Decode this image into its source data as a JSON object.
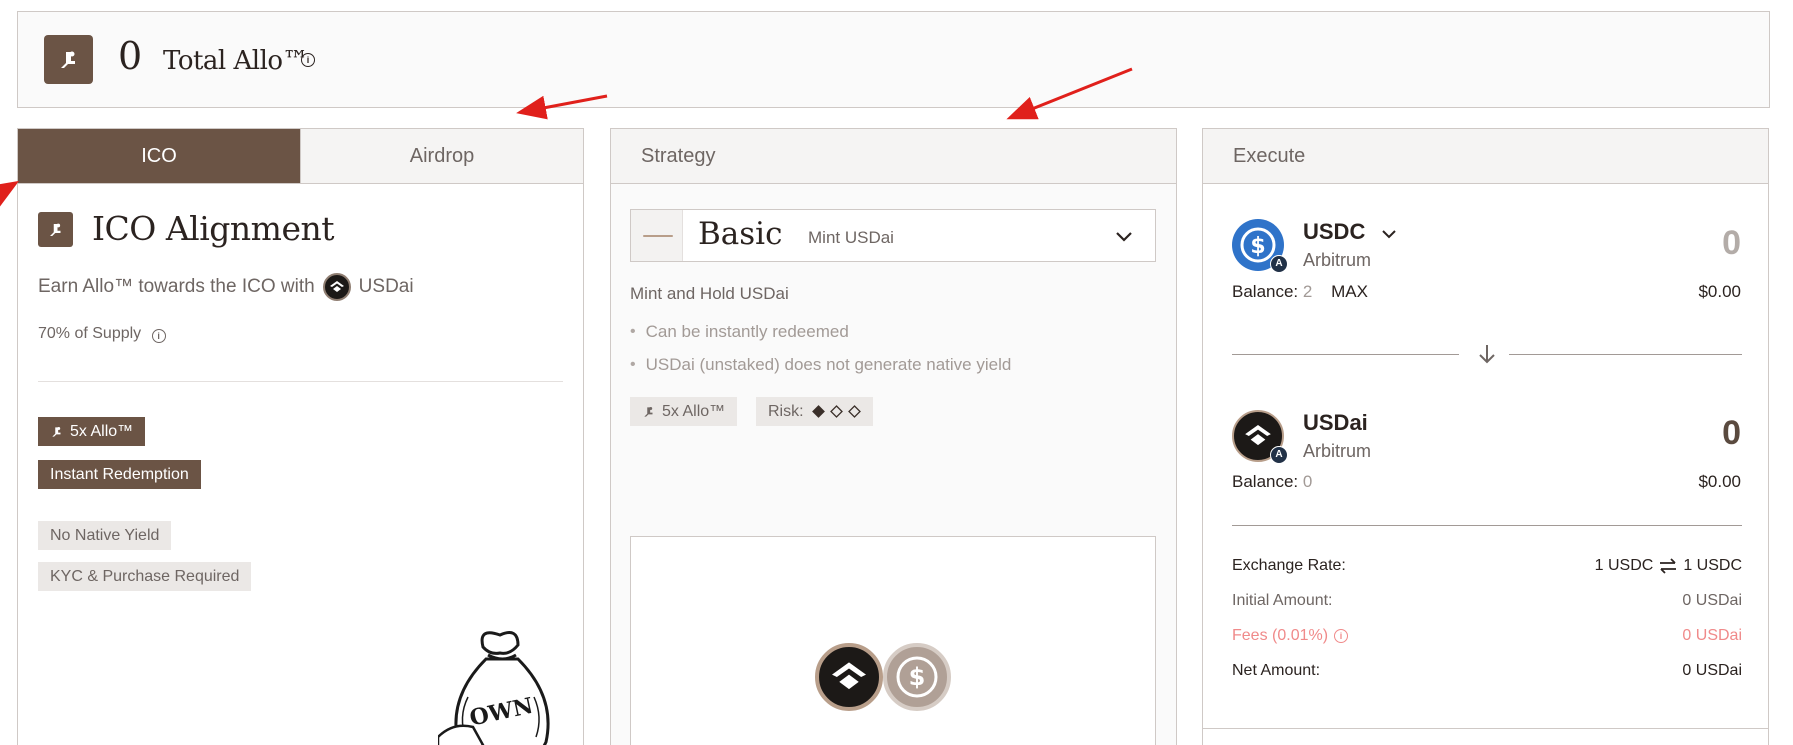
{
  "header": {
    "total_value": "0",
    "total_label": "Total Allo™",
    "info_glyph": "i"
  },
  "left_panel": {
    "tabs": [
      {
        "label": "ICO",
        "active": true
      },
      {
        "label": "Airdrop",
        "active": false
      }
    ],
    "title": "ICO Alignment",
    "earn_text": "Earn Allo™ towards the ICO with",
    "earn_token": "USDai",
    "supply_text": "70% of Supply",
    "badges_dark": [
      "5x Allo™",
      "Instant Redemption"
    ],
    "badges_light": [
      "No Native Yield",
      "KYC & Purchase Required"
    ],
    "bag_label": "OWN"
  },
  "mid_panel": {
    "header": "Strategy",
    "strategy_name": "Basic",
    "strategy_sub": "Mint USDai",
    "subtitle": "Mint and Hold USDai",
    "bullets": [
      "Can be instantly redeemed",
      "USDai (unstaked) does not generate native yield"
    ],
    "tag_allo": "5x Allo™",
    "tag_risk_label": "Risk:",
    "risk_level": 1,
    "risk_max": 3
  },
  "right_panel": {
    "header": "Execute",
    "from": {
      "token": "USDC",
      "network": "Arbitrum",
      "amount": "0",
      "balance_label": "Balance:",
      "balance": "2",
      "max_label": "MAX",
      "usd": "$0.00"
    },
    "to": {
      "token": "USDai",
      "network": "Arbitrum",
      "amount": "0",
      "balance_label": "Balance:",
      "balance": "0",
      "usd": "$0.00"
    },
    "details": {
      "exchange_rate_label": "Exchange Rate:",
      "rate_left": "1 USDC",
      "rate_right": "1 USDC",
      "initial_label": "Initial Amount:",
      "initial_value": "0 USDai",
      "fees_label": "Fees (0.01%)",
      "fees_value": "0 USDai",
      "net_label": "Net Amount:",
      "net_value": "0 USDai"
    }
  },
  "colors": {
    "brand_brown": "#6b5445",
    "usdc_blue": "#2f73c9",
    "fees_pink": "#f08a8a",
    "annotation_red": "#e0201b"
  }
}
